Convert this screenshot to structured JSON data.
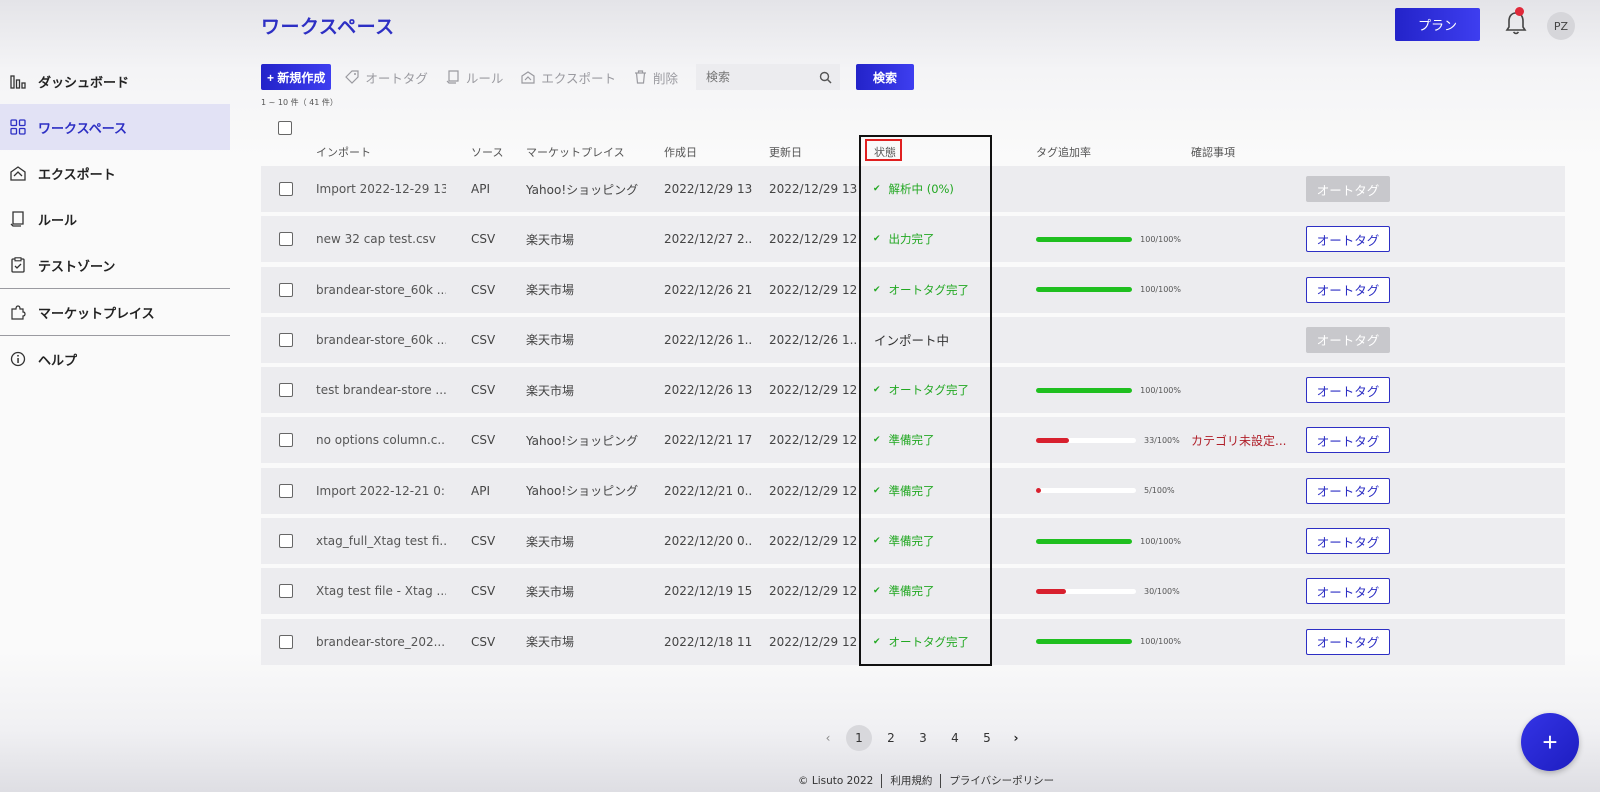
{
  "header": {
    "title": "ワークスペース",
    "plan_label": "プラン",
    "avatar_initials": "PZ"
  },
  "sidebar": {
    "items": [
      {
        "label": "ダッシュボード",
        "icon": "bar-chart-icon",
        "active": false
      },
      {
        "label": "ワークスペース",
        "icon": "grid-icon",
        "active": true
      },
      {
        "label": "エクスポート",
        "icon": "export-icon",
        "active": false
      },
      {
        "label": "ルール",
        "icon": "document-icon",
        "active": false
      },
      {
        "label": "テストゾーン",
        "icon": "clipboard-icon",
        "active": false
      },
      {
        "label": "マーケットプレイス",
        "icon": "puzzle-icon",
        "active": false
      },
      {
        "label": "ヘルプ",
        "icon": "info-icon",
        "active": false
      }
    ]
  },
  "toolbar": {
    "new_label": "+ 新規作成",
    "autotag_label": "オートタグ",
    "rule_label": "ルール",
    "export_label": "エクスポート",
    "delete_label": "削除",
    "search_placeholder": "検索",
    "search_button_label": "検索"
  },
  "result_count": "1 ~ 10 件（ 41 件）",
  "table": {
    "columns": {
      "import": "インポート",
      "source": "ソース",
      "marketplace": "マーケットプレイス",
      "created": "作成日",
      "updated": "更新日",
      "status": "状態",
      "tag_rate": "タグ追加率",
      "notes": "確認事項"
    },
    "action_label": "オートタグ",
    "rows": [
      {
        "name": "Import 2022-12-29 13...",
        "source": "API",
        "marketplace": "Yahoo!ショッピング",
        "created": "2022/12/29 13...",
        "updated": "2022/12/29 13...",
        "status": "解析中 (0%)",
        "status_type": "ok",
        "progress": null,
        "progress_label": "",
        "note": "",
        "action_enabled": false
      },
      {
        "name": "new 32 cap test.csv",
        "source": "CSV",
        "marketplace": "楽天市場",
        "created": "2022/12/27 2...",
        "updated": "2022/12/29 12...",
        "status": "出力完了",
        "status_type": "ok",
        "progress": 100,
        "progress_label": "100/100%",
        "note": "",
        "action_enabled": true
      },
      {
        "name": "brandear-store_60k ...",
        "source": "CSV",
        "marketplace": "楽天市場",
        "created": "2022/12/26 21...",
        "updated": "2022/12/29 12...",
        "status": "オートタグ完了",
        "status_type": "ok",
        "progress": 100,
        "progress_label": "100/100%",
        "note": "",
        "action_enabled": true
      },
      {
        "name": "brandear-store_60k ...",
        "source": "CSV",
        "marketplace": "楽天市場",
        "created": "2022/12/26 1...",
        "updated": "2022/12/26 1...",
        "status": "インポート中",
        "status_type": "plain",
        "progress": null,
        "progress_label": "",
        "note": "",
        "action_enabled": false
      },
      {
        "name": "test brandear-store ...",
        "source": "CSV",
        "marketplace": "楽天市場",
        "created": "2022/12/26 13...",
        "updated": "2022/12/29 12...",
        "status": "オートタグ完了",
        "status_type": "ok",
        "progress": 100,
        "progress_label": "100/100%",
        "note": "",
        "action_enabled": true
      },
      {
        "name": "no options column.c...",
        "source": "CSV",
        "marketplace": "Yahoo!ショッピング",
        "created": "2022/12/21 17:...",
        "updated": "2022/12/29 12...",
        "status": "準備完了",
        "status_type": "ok",
        "progress": 33,
        "progress_label": "33/100%",
        "note": "カテゴリ未設定...",
        "action_enabled": true
      },
      {
        "name": "Import 2022-12-21 0:...",
        "source": "API",
        "marketplace": "Yahoo!ショッピング",
        "created": "2022/12/21 0...",
        "updated": "2022/12/29 12...",
        "status": "準備完了",
        "status_type": "ok",
        "progress": 5,
        "progress_label": "5/100%",
        "note": "",
        "action_enabled": true
      },
      {
        "name": "xtag_full_Xtag test fi...",
        "source": "CSV",
        "marketplace": "楽天市場",
        "created": "2022/12/20 0...",
        "updated": "2022/12/29 12...",
        "status": "準備完了",
        "status_type": "ok",
        "progress": 100,
        "progress_label": "100/100%",
        "note": "",
        "action_enabled": true
      },
      {
        "name": "Xtag test file - Xtag ...",
        "source": "CSV",
        "marketplace": "楽天市場",
        "created": "2022/12/19 15:...",
        "updated": "2022/12/29 12...",
        "status": "準備完了",
        "status_type": "ok",
        "progress": 30,
        "progress_label": "30/100%",
        "note": "",
        "action_enabled": true
      },
      {
        "name": "brandear-store_202...",
        "source": "CSV",
        "marketplace": "楽天市場",
        "created": "2022/12/18 11:...",
        "updated": "2022/12/29 12...",
        "status": "オートタグ完了",
        "status_type": "ok",
        "progress": 100,
        "progress_label": "100/100%",
        "note": "",
        "action_enabled": true
      }
    ]
  },
  "pagination": {
    "pages": [
      "1",
      "2",
      "3",
      "4",
      "5"
    ],
    "current": "1"
  },
  "footer": {
    "copyright": "© Lisuto 2022",
    "terms": "利用規約",
    "privacy": "プライバシーポリシー"
  },
  "fab_label": "+",
  "colors": {
    "accent": "#2d2fc4",
    "success": "#22a822",
    "progress_full": "#1fbf1f",
    "progress_low": "#d8202e",
    "warning_text": "#b0202a"
  }
}
